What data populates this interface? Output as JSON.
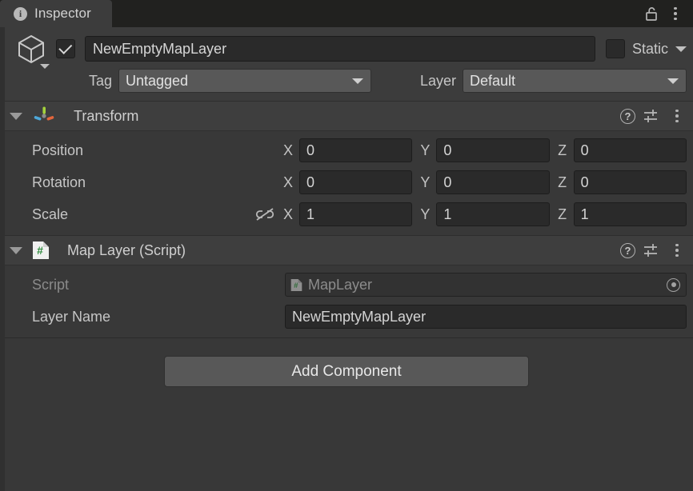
{
  "window": {
    "tab_label": "Inspector",
    "tab_icon": "info-icon",
    "lock_icon": "unlocked-padlock-icon",
    "menu_icon": "kebab-menu-icon"
  },
  "gameobject": {
    "object_icon": "cube-icon",
    "enabled": true,
    "name": "NewEmptyMapLayer",
    "static_label": "Static",
    "static_checked": false,
    "tag_label": "Tag",
    "tag_value": "Untagged",
    "layer_label": "Layer",
    "layer_value": "Default"
  },
  "transform": {
    "title": "Transform",
    "icon": "transform-gizmo-icon",
    "help_icon": "help-icon",
    "preset_icon": "preset-sliders-icon",
    "menu_icon": "kebab-menu-icon",
    "rows": [
      {
        "label": "Position",
        "x": "0",
        "y": "0",
        "z": "0",
        "constrain_icon": null
      },
      {
        "label": "Rotation",
        "x": "0",
        "y": "0",
        "z": "0",
        "constrain_icon": null
      },
      {
        "label": "Scale",
        "x": "1",
        "y": "1",
        "z": "1",
        "constrain_icon": "constrain-proportions-off-icon"
      }
    ],
    "axis_x": "X",
    "axis_y": "Y",
    "axis_z": "Z"
  },
  "map_layer": {
    "title": "Map Layer (Script)",
    "icon": "cs-script-icon",
    "help_icon": "help-icon",
    "preset_icon": "preset-sliders-icon",
    "menu_icon": "kebab-menu-icon",
    "script_label": "Script",
    "script_value": "MapLayer",
    "script_value_icon": "cs-script-icon",
    "picker_icon": "object-picker-icon",
    "layer_name_label": "Layer Name",
    "layer_name_value": "NewEmptyMapLayer"
  },
  "footer": {
    "add_component_label": "Add Component"
  },
  "colors": {
    "window_bg": "#383838",
    "tabbar_bg": "#21211f",
    "tab_active_bg": "#3c3c3c",
    "component_header_bg": "#3e3e3e",
    "field_bg": "#2a2a2a",
    "dropdown_bg": "#585858",
    "text": "#c4c4c4",
    "script_green": "#2e8b3d",
    "gizmo_green": "#a4d23c",
    "gizmo_blue": "#4ea7d8",
    "gizmo_orange": "#e2653c"
  }
}
